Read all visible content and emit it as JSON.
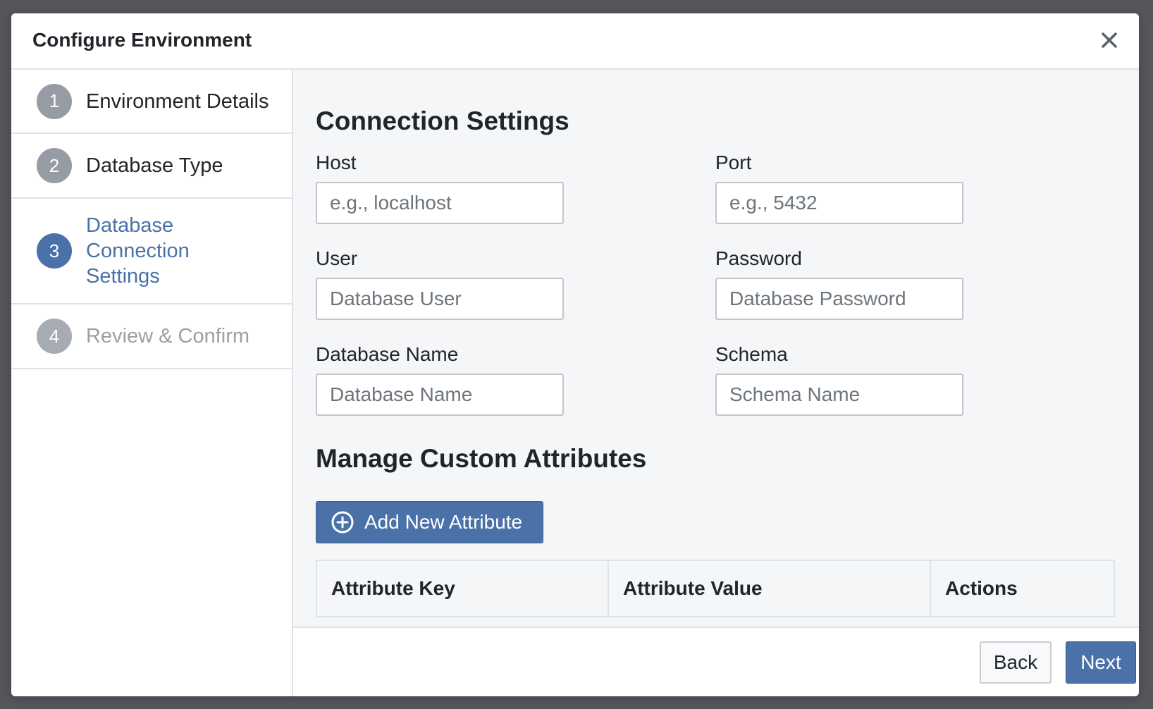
{
  "modal": {
    "title": "Configure Environment",
    "close_icon": "close-icon"
  },
  "steps": [
    {
      "number": "1",
      "label": "Environment Details",
      "state": "completed"
    },
    {
      "number": "2",
      "label": "Database Type",
      "state": "completed"
    },
    {
      "number": "3",
      "label": "Database Connection Settings",
      "state": "active"
    },
    {
      "number": "4",
      "label": "Review & Confirm",
      "state": "disabled"
    }
  ],
  "connection": {
    "title": "Connection Settings",
    "fields": {
      "host": {
        "label": "Host",
        "placeholder": "e.g., localhost",
        "value": ""
      },
      "port": {
        "label": "Port",
        "placeholder": "e.g., 5432",
        "value": ""
      },
      "user": {
        "label": "User",
        "placeholder": "Database User",
        "value": ""
      },
      "password": {
        "label": "Password",
        "placeholder": "Database Password",
        "value": ""
      },
      "database_name": {
        "label": "Database Name",
        "placeholder": "Database Name",
        "value": ""
      },
      "schema": {
        "label": "Schema",
        "placeholder": "Schema Name",
        "value": ""
      }
    }
  },
  "attributes": {
    "title": "Manage Custom Attributes",
    "add_button_label": "Add New Attribute",
    "add_button_icon": "plus-circle-icon",
    "columns": [
      "Attribute Key",
      "Attribute Value",
      "Actions"
    ],
    "rows": []
  },
  "footer": {
    "back_label": "Back",
    "next_label": "Next"
  },
  "colors": {
    "primary": "#4a72a8",
    "step_inactive": "#979ba3",
    "backdrop": "#55565c",
    "content_bg": "#f5f6f8"
  }
}
